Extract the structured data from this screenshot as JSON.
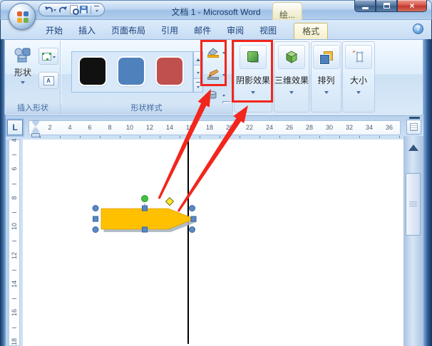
{
  "window": {
    "title": "文档 1 - Microsoft Word",
    "contextual_tab_group": "绘...",
    "tab_selector": "L",
    "help_label": "?"
  },
  "qat": {
    "buttons": [
      "undo",
      "redo",
      "print-preview",
      "save",
      "customize-quick-access-toolbar"
    ]
  },
  "tabs": {
    "items": [
      {
        "label": "开始",
        "active": false
      },
      {
        "label": "插入",
        "active": false
      },
      {
        "label": "页面布局",
        "active": false
      },
      {
        "label": "引用",
        "active": false
      },
      {
        "label": "邮件",
        "active": false
      },
      {
        "label": "审阅",
        "active": false
      },
      {
        "label": "视图",
        "active": false
      },
      {
        "label": "格式",
        "active": true
      }
    ]
  },
  "ribbon": {
    "insert_shapes": {
      "label": "插入形状",
      "shapes_button": "形状",
      "textbox_icon_letter": "A"
    },
    "shape_styles": {
      "label": "形状样式",
      "swatches": [
        {
          "name": "black",
          "color": "#111111"
        },
        {
          "name": "blue",
          "color": "#4f81bd"
        },
        {
          "name": "red",
          "color": "#c0504d"
        }
      ]
    },
    "big_buttons": [
      {
        "label": "阴影效果",
        "highlighted": true
      },
      {
        "label": "三维效果",
        "highlighted": false
      },
      {
        "label": "排列",
        "highlighted": false
      },
      {
        "label": "大小",
        "highlighted": false
      }
    ]
  },
  "ruler": {
    "horizontal_numbers": [
      2,
      4,
      6,
      8,
      10,
      12,
      14,
      16,
      18,
      20,
      22,
      24,
      26,
      28,
      30,
      32,
      34,
      36
    ],
    "vertical_numbers": [
      4,
      6,
      8,
      10,
      12,
      14,
      16,
      18
    ]
  },
  "document": {
    "shape": {
      "fill": "#FFC000",
      "outline": "#DA9E00"
    },
    "handles": {
      "blue": "#5a8ac4",
      "rotate_green": "#3fc43f",
      "adjust_yellow": "#ffe927"
    },
    "line_color": "#000000"
  },
  "annotations": {
    "red": "#f2261c"
  }
}
